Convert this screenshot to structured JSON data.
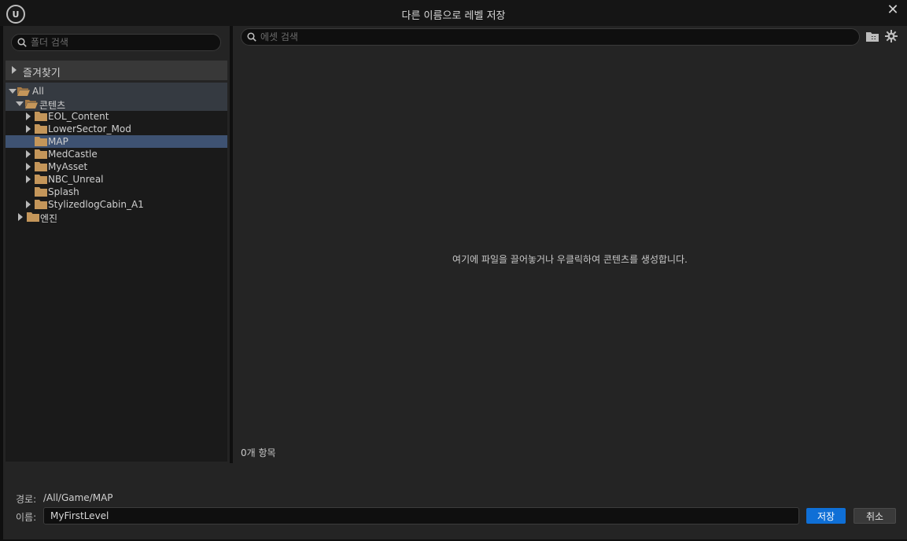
{
  "window": {
    "title": "다른 이름으로 레벨 저장",
    "logo_text": "U",
    "close_glyph": "✕"
  },
  "folder_search": {
    "placeholder": "폴더 검색"
  },
  "favorites": {
    "label": "즐겨찾기"
  },
  "tree": {
    "root": "All",
    "content": "콘텐츠",
    "items": [
      {
        "label": "EOL_Content",
        "expandable": true
      },
      {
        "label": "LowerSector_Mod",
        "expandable": true
      },
      {
        "label": "MAP",
        "expandable": false,
        "selected": true
      },
      {
        "label": "MedCastle",
        "expandable": true
      },
      {
        "label": "MyAsset",
        "expandable": true
      },
      {
        "label": "NBC_Unreal",
        "expandable": true
      },
      {
        "label": "Splash",
        "expandable": false
      },
      {
        "label": "StylizedlogCabin_A1",
        "expandable": true
      }
    ],
    "engine": "엔진"
  },
  "asset_search": {
    "placeholder": "에셋 검색"
  },
  "content_area": {
    "empty_message": "여기에 파일을 끌어놓거나 우클릭하여 콘텐츠를 생성합니다.",
    "item_count": "0개 항목"
  },
  "save_form": {
    "path_label": "경로:",
    "path_value": "/All/Game/MAP",
    "name_label": "이름:",
    "name_value": "MyFirstLevel",
    "save_label": "저장",
    "cancel_label": "취소"
  },
  "colors": {
    "folder": "#c4965a",
    "selected_row": "#3e5272",
    "save_button": "#0f6fd6"
  },
  "icons": [
    "unreal-logo-icon",
    "close-icon",
    "search-icon",
    "folder-icon",
    "folder-open-icon",
    "add-folder-icon",
    "settings-gear-icon"
  ]
}
